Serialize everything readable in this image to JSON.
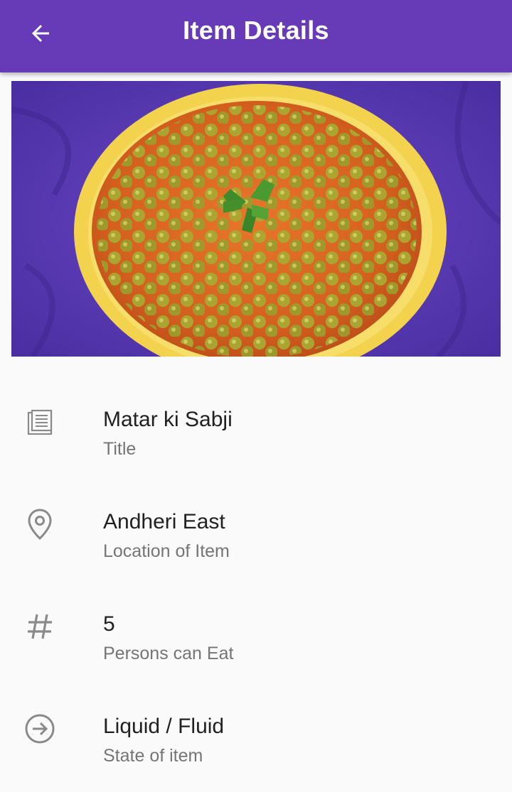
{
  "appbar": {
    "title": "Item Details",
    "back_icon": "arrow-back-icon",
    "color": "#673ab7"
  },
  "hero": {
    "image_icon": "food-photo",
    "background_color": "#5b3ab8"
  },
  "details": [
    {
      "icon": "article-icon",
      "value": "Matar ki Sabji",
      "label": "Title"
    },
    {
      "icon": "location-pin-icon",
      "value": "Andheri East",
      "label": "Location of Item"
    },
    {
      "icon": "hash-icon",
      "value": "5",
      "label": "Persons can Eat"
    },
    {
      "icon": "arrow-circle-right-icon",
      "value": "Liquid / Fluid",
      "label": "State of item"
    }
  ]
}
